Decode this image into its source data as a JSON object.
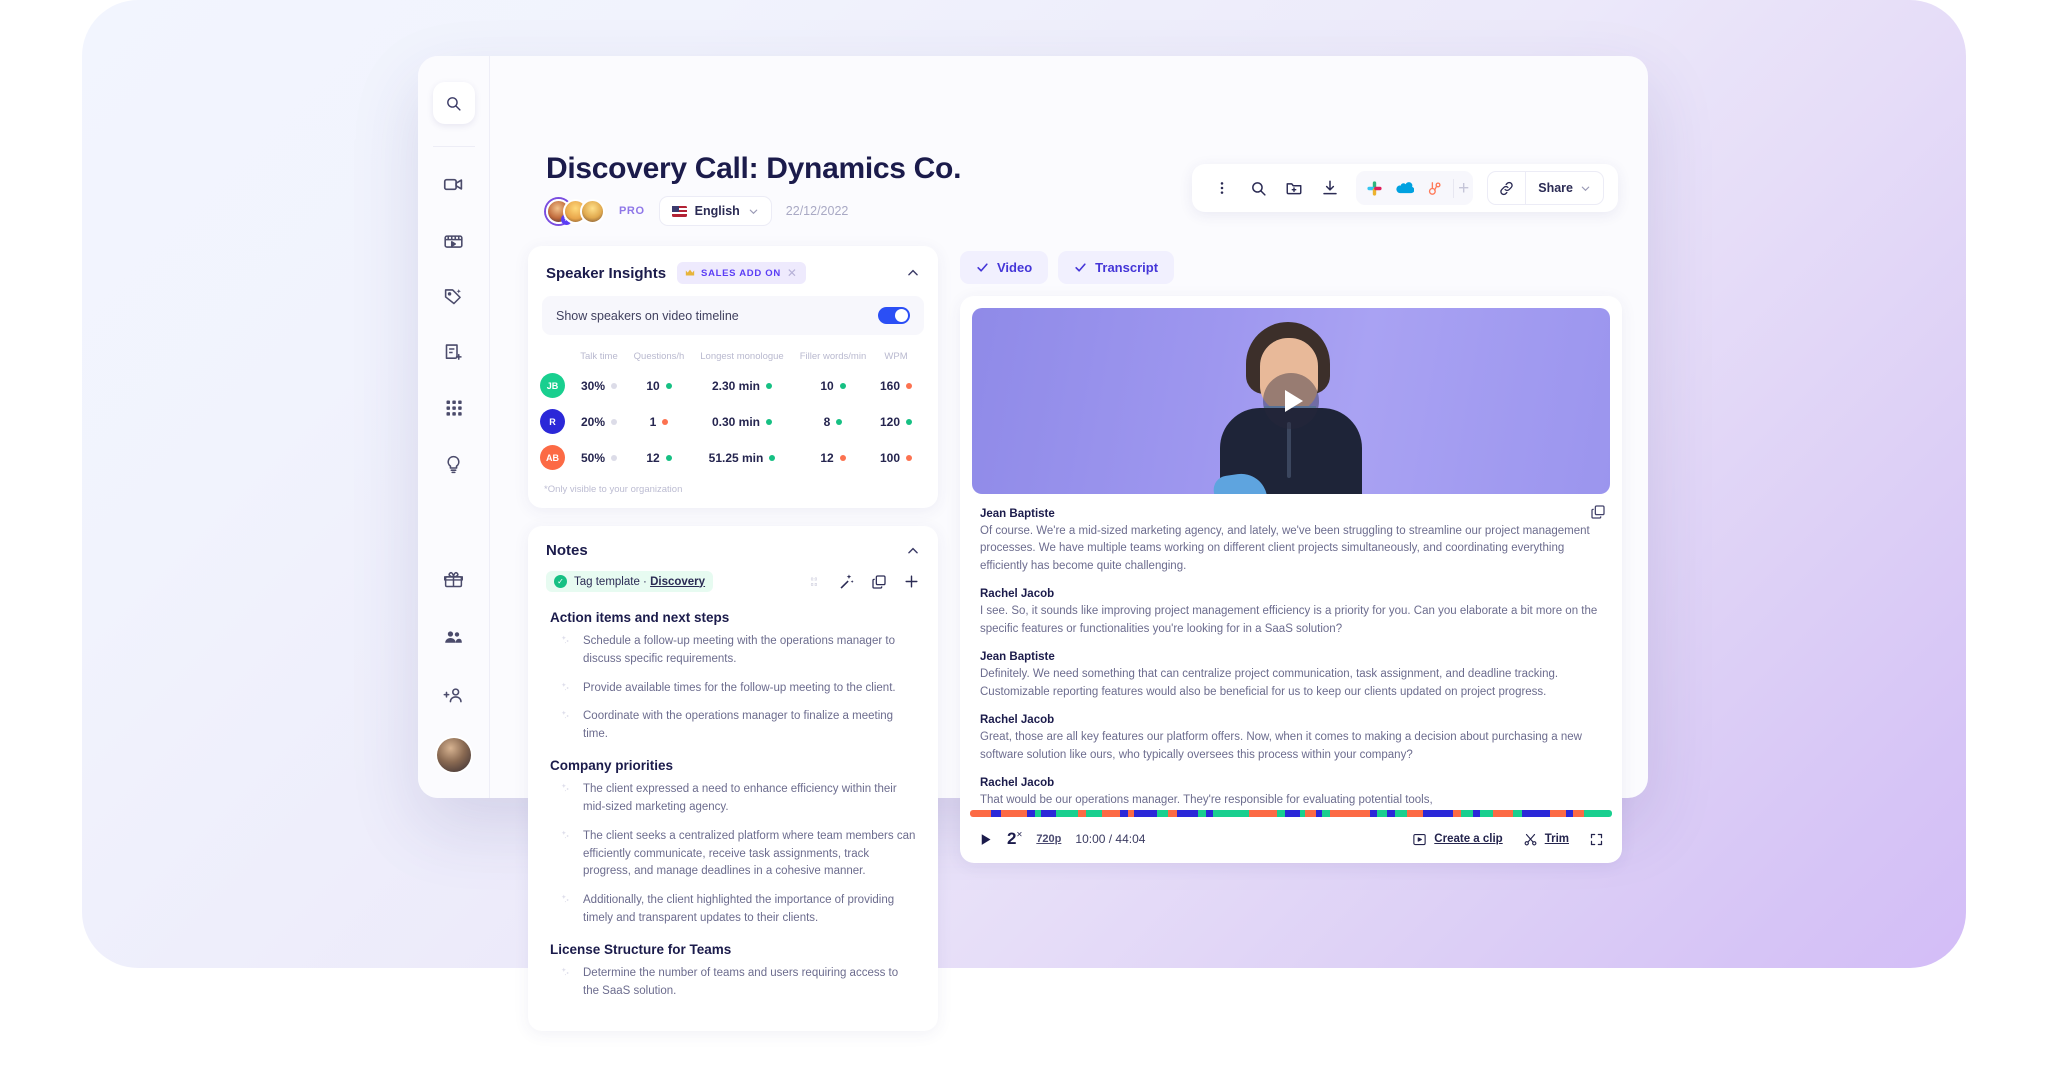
{
  "header": {
    "title": "Discovery Call: Dynamics Co.",
    "pro_badge": "PRO",
    "language": "English",
    "date": "22/12/2022",
    "share_label": "Share"
  },
  "sidebar": {
    "search_icon": "search-icon",
    "items": [
      {
        "icon": "video-camera-icon",
        "name": "recordings"
      },
      {
        "icon": "clapperboard-icon",
        "name": "clips"
      },
      {
        "icon": "tag-sparkle-icon",
        "name": "smart-tags"
      },
      {
        "icon": "note-add-icon",
        "name": "templates"
      },
      {
        "icon": "grid-apps-icon",
        "name": "apps"
      },
      {
        "icon": "lightbulb-icon",
        "name": "insights"
      }
    ],
    "bottom_items": [
      {
        "icon": "gift-icon",
        "name": "referrals"
      },
      {
        "icon": "people-icon",
        "name": "team"
      },
      {
        "icon": "add-person-icon",
        "name": "invite"
      }
    ],
    "avatar": "user-avatar"
  },
  "toolbar": {
    "icons": [
      "kebab-menu-icon",
      "search-icon",
      "folder-add-icon",
      "download-icon"
    ],
    "integrations": [
      "slack-icon",
      "salesforce-icon",
      "hubspot-icon"
    ],
    "add_integration": "+",
    "link_icon": "link-icon"
  },
  "speaker_insights": {
    "title": "Speaker Insights",
    "addon_badge": "SALES ADD ON",
    "addon_icon": "crown-icon",
    "toggle_label": "Show speakers on video timeline",
    "toggle_on": true,
    "columns": [
      "Talk time",
      "Questions/h",
      "Longest monologue",
      "Filler words/min",
      "WPM"
    ],
    "rows": [
      {
        "initials": "JB",
        "avatar_color": "#19cf8f",
        "values": [
          "30%",
          "10",
          "2.30 min",
          "10",
          "160"
        ],
        "dots": [
          "#dcdce8",
          "#16c083",
          "#16c083",
          "#16c083",
          "#fc7250"
        ]
      },
      {
        "initials": "R",
        "avatar_color": "#2b28d8",
        "values": [
          "20%",
          "1",
          "0.30 min",
          "8",
          "120"
        ],
        "dots": [
          "#dcdce8",
          "#fc7250",
          "#16c083",
          "#16c083",
          "#16c083"
        ]
      },
      {
        "initials": "AB",
        "avatar_color": "#fc6a45",
        "values": [
          "50%",
          "12",
          "51.25 min",
          "12",
          "100"
        ],
        "dots": [
          "#dcdce8",
          "#16c083",
          "#16c083",
          "#fc7250",
          "#fc7250"
        ]
      }
    ],
    "footnote": "*Only visible to your organization"
  },
  "notes": {
    "title": "Notes",
    "tag_prefix": "Tag template · ",
    "tag_name": "Discovery",
    "actions": [
      "ai-summary-icon",
      "magic-wand-icon",
      "copy-icon",
      "plus-icon"
    ],
    "sections": [
      {
        "heading": "Action items and next steps",
        "items": [
          "Schedule a follow-up meeting with the operations manager to discuss specific requirements.",
          "Provide available times for the follow-up meeting to the client.",
          "Coordinate with the operations manager to finalize a meeting time."
        ]
      },
      {
        "heading": "Company priorities",
        "items": [
          "The client expressed a need to enhance efficiency within their mid-sized marketing agency.",
          "The client seeks a centralized platform where team members can efficiently communicate, receive task assignments, track progress, and manage deadlines in a cohesive manner.",
          "Additionally, the client highlighted the importance of providing timely and transparent updates to their clients."
        ]
      },
      {
        "heading": "License Structure for Teams",
        "items": [
          "Determine the number of teams and users requiring access to the SaaS solution."
        ]
      }
    ]
  },
  "tabs": [
    {
      "label": "Video",
      "checked": true
    },
    {
      "label": "Transcript",
      "checked": true
    }
  ],
  "transcript": {
    "copy_icon": "copy-icon",
    "entries": [
      {
        "speaker": "Jean Baptiste",
        "text": "Of course. We're a mid-sized marketing agency, and lately, we've been struggling to streamline our project management processes. We have multiple teams working on different client projects simultaneously, and coordinating everything efficiently has become quite challenging."
      },
      {
        "speaker": "Rachel Jacob",
        "text": "I see. So, it sounds like improving project management efficiency is a priority for you. Can you elaborate a bit more on the specific features or functionalities you're looking for in a SaaS solution?"
      },
      {
        "speaker": "Jean Baptiste",
        "text": "Definitely. We need something that can centralize project communication, task assignment, and deadline tracking. Customizable reporting features would also be beneficial for us to keep our clients updated on project progress."
      },
      {
        "speaker": "Rachel Jacob",
        "text": "Great, those are all key features our platform offers. Now, when it comes to making a decision about purchasing a new software solution like ours, who typically oversees this process within your company?"
      },
      {
        "speaker": "Rachel Jacob",
        "text": "That would be our operations manager. They're responsible for evaluating potential tools,"
      }
    ]
  },
  "player": {
    "play_icon": "play-icon",
    "speed": "2",
    "speed_suffix": "×",
    "resolution": "720p",
    "timecode": "10:00 / 44:04",
    "create_clip_label": "Create a clip",
    "trim_label": "Trim",
    "fullscreen_icon": "fullscreen-icon",
    "timeline_segments": [
      {
        "color": "#fc6a45",
        "width": 3.2
      },
      {
        "color": "#2b28d8",
        "width": 1.4
      },
      {
        "color": "#fc6a45",
        "width": 4.0
      },
      {
        "color": "#2b28d8",
        "width": 1.1
      },
      {
        "color": "#19cf8f",
        "width": 1.0
      },
      {
        "color": "#2b28d8",
        "width": 2.2
      },
      {
        "color": "#19cf8f",
        "width": 3.2
      },
      {
        "color": "#fc6a45",
        "width": 1.3
      },
      {
        "color": "#19cf8f",
        "width": 2.4
      },
      {
        "color": "#fc6a45",
        "width": 2.6
      },
      {
        "color": "#2b28d8",
        "width": 1.2
      },
      {
        "color": "#fc6a45",
        "width": 1.0
      },
      {
        "color": "#2b28d8",
        "width": 3.4
      },
      {
        "color": "#19cf8f",
        "width": 1.6
      },
      {
        "color": "#fc6a45",
        "width": 1.4
      },
      {
        "color": "#2b28d8",
        "width": 3.2
      },
      {
        "color": "#19cf8f",
        "width": 1.2
      },
      {
        "color": "#2b28d8",
        "width": 1.0
      },
      {
        "color": "#19cf8f",
        "width": 5.4
      },
      {
        "color": "#fc6a45",
        "width": 4.2
      },
      {
        "color": "#19cf8f",
        "width": 1.2
      },
      {
        "color": "#2b28d8",
        "width": 2.2
      },
      {
        "color": "#19cf8f",
        "width": 0.8
      },
      {
        "color": "#fc6a45",
        "width": 1.6
      },
      {
        "color": "#2b28d8",
        "width": 0.9
      },
      {
        "color": "#19cf8f",
        "width": 1.2
      },
      {
        "color": "#fc6a45",
        "width": 6.0
      },
      {
        "color": "#2b28d8",
        "width": 1.0
      },
      {
        "color": "#19cf8f",
        "width": 1.6
      },
      {
        "color": "#2b28d8",
        "width": 1.2
      },
      {
        "color": "#19cf8f",
        "width": 1.8
      },
      {
        "color": "#fc6a45",
        "width": 2.4
      },
      {
        "color": "#2b28d8",
        "width": 4.4
      },
      {
        "color": "#fc6a45",
        "width": 1.2
      },
      {
        "color": "#19cf8f",
        "width": 1.8
      },
      {
        "color": "#2b28d8",
        "width": 1.0
      },
      {
        "color": "#19cf8f",
        "width": 2.0
      },
      {
        "color": "#fc6a45",
        "width": 3.0
      },
      {
        "color": "#19cf8f",
        "width": 1.4
      },
      {
        "color": "#2b28d8",
        "width": 4.2
      },
      {
        "color": "#fc6a45",
        "width": 2.4
      },
      {
        "color": "#2b28d8",
        "width": 1.0
      },
      {
        "color": "#fc6a45",
        "width": 1.6
      },
      {
        "color": "#19cf8f",
        "width": 4.2
      }
    ]
  },
  "colors": {
    "accent": "#5b3df5",
    "title": "#1b1b4b",
    "green": "#16c083",
    "orange": "#fc7250",
    "blue": "#2b28d8"
  }
}
